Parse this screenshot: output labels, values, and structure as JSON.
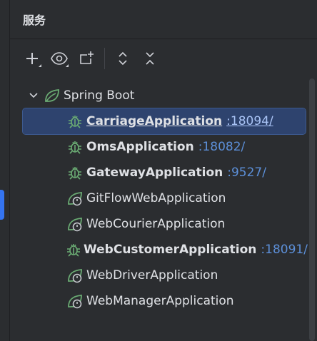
{
  "panel": {
    "title": "服务"
  },
  "toolbar": {
    "buttons": [
      {
        "name": "add-service-button",
        "icon": "plus-icon"
      },
      {
        "name": "view-options-button",
        "icon": "eye-icon"
      },
      {
        "name": "new-tab-button",
        "icon": "new-tab-icon"
      },
      {
        "name": "expand-all-button",
        "icon": "expand-icon"
      },
      {
        "name": "collapse-all-button",
        "icon": "collapse-icon"
      }
    ]
  },
  "tree": {
    "root": {
      "label": "Spring Boot",
      "expanded": true
    },
    "items": [
      {
        "label": "CarriageApplication",
        "port": ":18094/",
        "running": true,
        "selected": true
      },
      {
        "label": "OmsApplication",
        "port": ":18082/",
        "running": true,
        "selected": false
      },
      {
        "label": "GatewayApplication",
        "port": ":9527/",
        "running": true,
        "selected": false
      },
      {
        "label": "GitFlowWebApplication",
        "port": "",
        "running": false,
        "selected": false
      },
      {
        "label": "WebCourierApplication",
        "port": "",
        "running": false,
        "selected": false
      },
      {
        "label": "WebCustomerApplication",
        "port": ":18091/",
        "running": true,
        "selected": false
      },
      {
        "label": "WebDriverApplication",
        "port": "",
        "running": false,
        "selected": false
      },
      {
        "label": "WebManagerApplication",
        "port": "",
        "running": false,
        "selected": false
      }
    ]
  },
  "colors": {
    "accent": "#3574f0",
    "port_link": "#5c8fd8",
    "spring_green": "#6aab73"
  }
}
